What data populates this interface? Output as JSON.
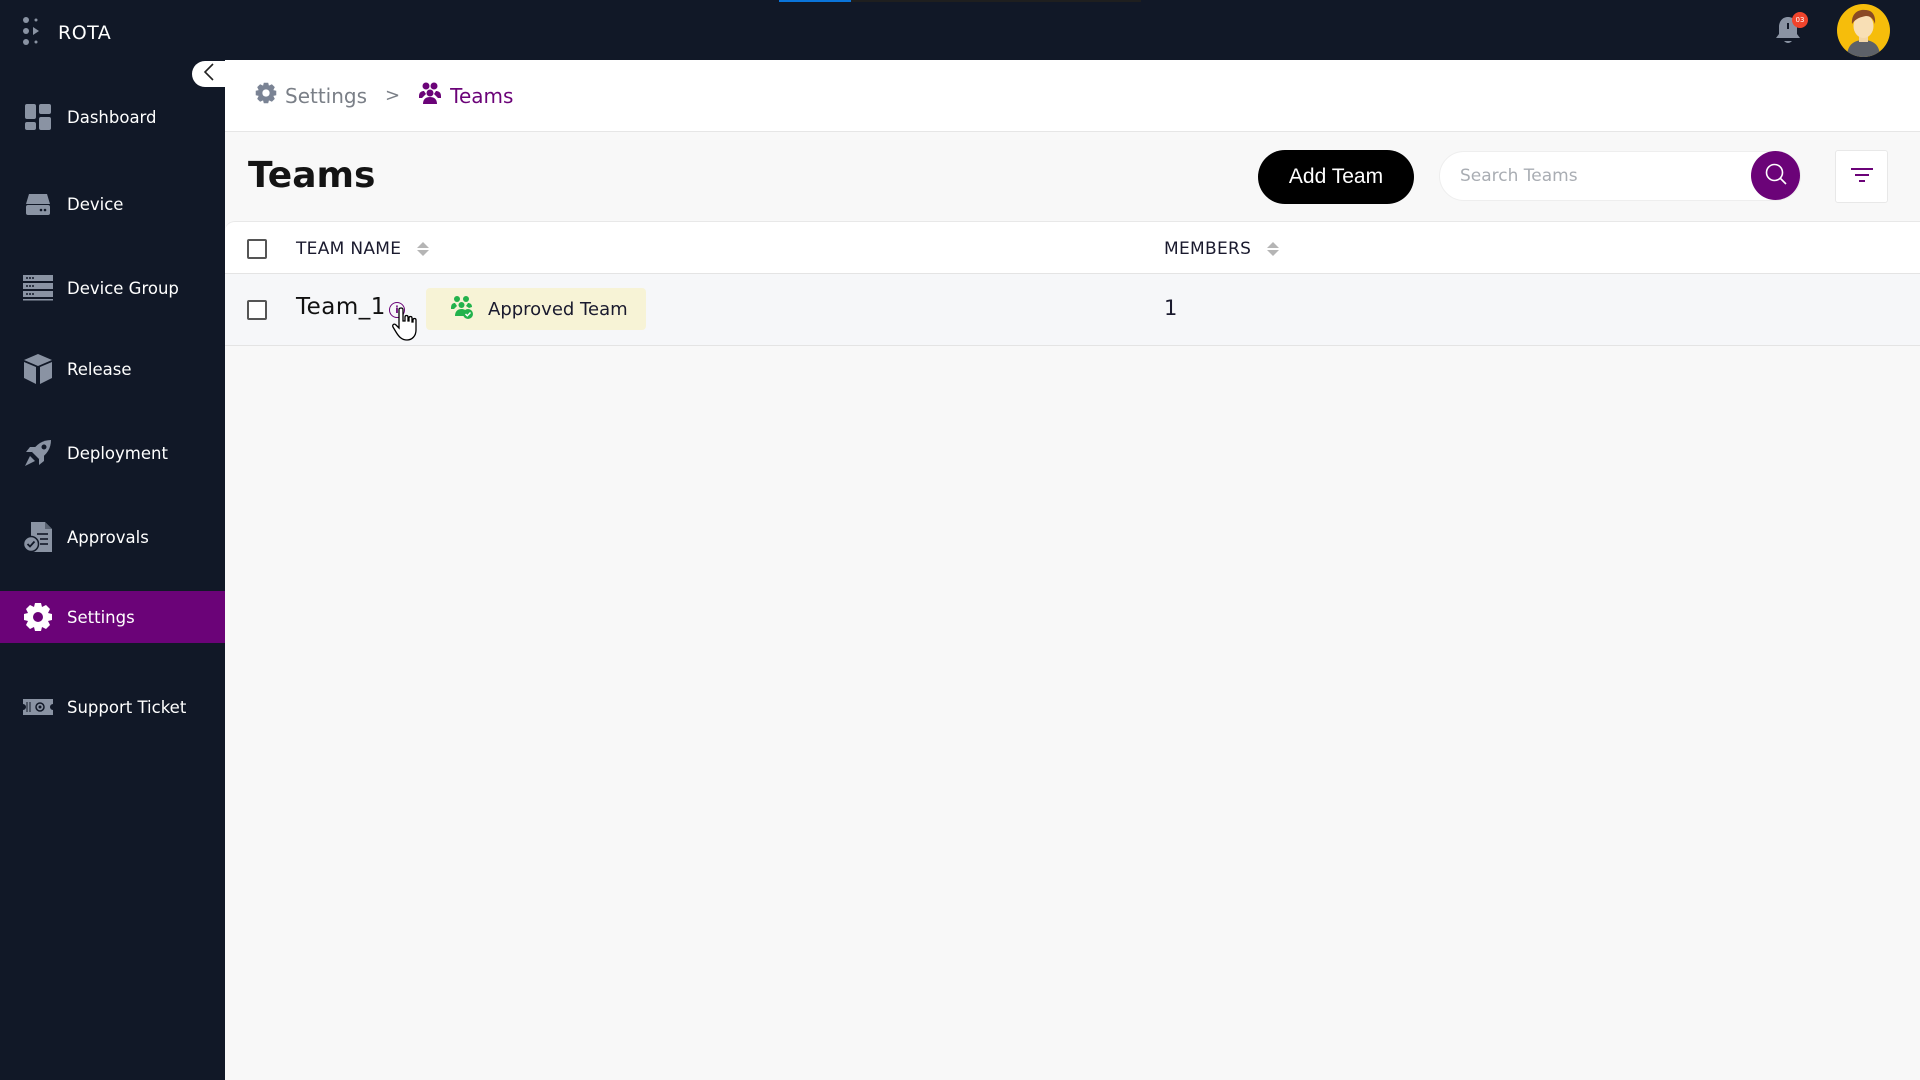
{
  "app": {
    "name": "ROTA",
    "loading_progress_percent": 20,
    "notification_count": "03",
    "icons": {
      "logo": "dots-logo-icon",
      "bell": "bell-icon",
      "avatar": "user-avatar"
    }
  },
  "sidebar": {
    "items": [
      {
        "label": "Dashboard",
        "icon": "dashboard-icon",
        "active": false
      },
      {
        "label": "Device",
        "icon": "hard-drive-icon",
        "active": false
      },
      {
        "label": "Device Group",
        "icon": "server-rack-icon",
        "active": false
      },
      {
        "label": "Release",
        "icon": "box-icon",
        "active": false
      },
      {
        "label": "Deployment",
        "icon": "rocket-icon",
        "active": false
      },
      {
        "label": "Approvals",
        "icon": "document-check-icon",
        "active": false
      },
      {
        "label": "Settings",
        "icon": "gear-icon",
        "active": true
      },
      {
        "label": "Support Ticket",
        "icon": "ticket-gear-icon",
        "active": false
      }
    ],
    "active_color": "#6b0378",
    "background": "#111827"
  },
  "breadcrumb": {
    "items": [
      {
        "label": "Settings",
        "icon": "gear-icon"
      },
      {
        "label": "Teams",
        "icon": "users-icon"
      }
    ],
    "separator": ">"
  },
  "page": {
    "title": "Teams",
    "add_button_label": "Add Team",
    "search": {
      "placeholder": "Search Teams",
      "value": ""
    }
  },
  "table": {
    "columns": [
      {
        "label": "TEAM NAME",
        "sortable": true
      },
      {
        "label": "MEMBERS",
        "sortable": true
      }
    ],
    "rows": [
      {
        "team_name": "Team_1",
        "badge": "Approved Team",
        "members": "1",
        "info_icon": "i"
      }
    ]
  },
  "colors": {
    "brand_purple": "#6b0378",
    "topbar": "#111827",
    "badge_bg": "#f7f3d6",
    "badge_icon": "#22b24c",
    "notification": "#f0442c"
  }
}
